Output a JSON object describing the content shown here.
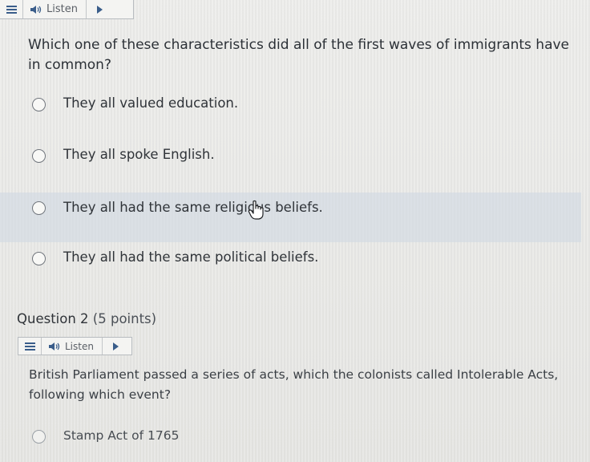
{
  "toolbar": {
    "listen_label": "Listen"
  },
  "question1": {
    "text": "Which one of these characteristics did all of the first waves of immigrants have in common?",
    "options": [
      {
        "label": "They all valued education."
      },
      {
        "label": "They all spoke English."
      },
      {
        "label": "They all had the same religious beliefs."
      },
      {
        "label": "They all had the same political beliefs."
      }
    ]
  },
  "question2": {
    "header": "Question 2",
    "points": "(5 points)",
    "text": "British Parliament passed a series of acts, which the colonists called Intolerable Acts, following which event?",
    "options": [
      {
        "label": "Stamp Act of 1765"
      }
    ]
  },
  "colors": {
    "accent": "#3a5d8a",
    "highlight_row": "#cdd7e2"
  }
}
